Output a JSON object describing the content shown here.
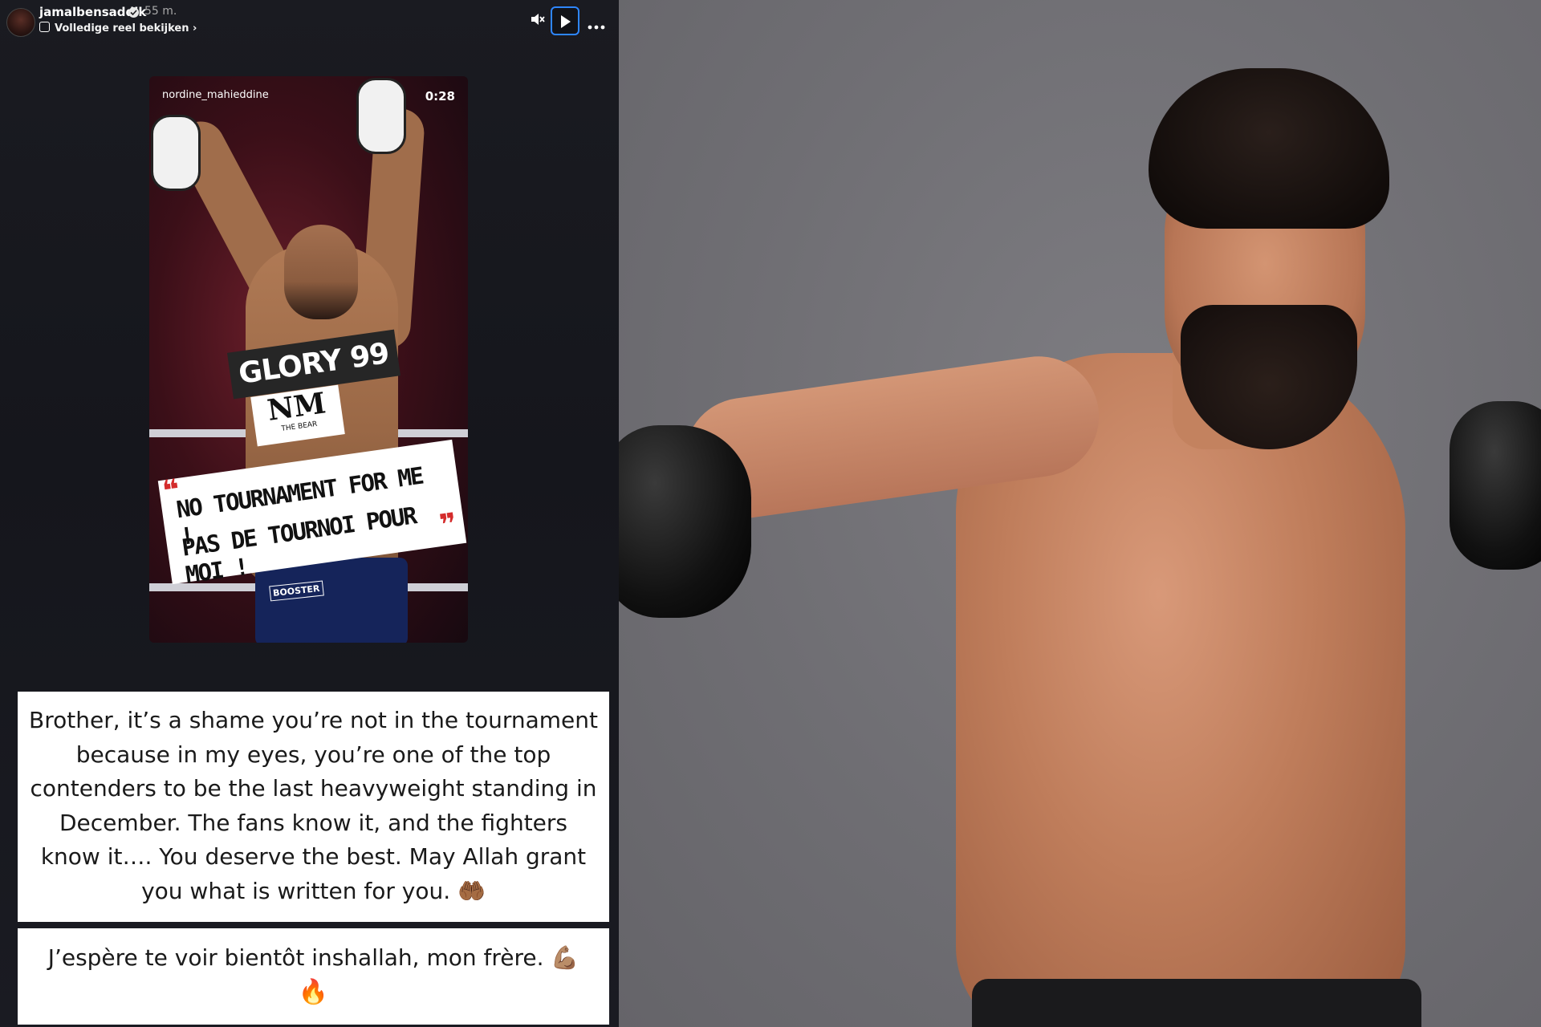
{
  "story": {
    "username": "jamalbensaddik",
    "time_ago": "55 m.",
    "reel_link": "Volledige reel bekijken",
    "icons": {
      "avatar": "profile-avatar",
      "verified": "verified-badge-icon",
      "mute": "speaker-muted-icon",
      "play": "play-icon",
      "more": "more-options-icon",
      "reel": "reel-icon",
      "chevron": "chevron-right-icon"
    },
    "chevron_char": "›"
  },
  "reel": {
    "author": "nordine_mahieddine",
    "duration": "0:28",
    "banner_title": "GLORY 99",
    "logo_mark": "NM",
    "logo_sub": "THE BEAR",
    "headline_line1": "NO TOURNAMENT FOR ME !",
    "headline_line2": "PAS DE TOURNOI POUR MOI !",
    "shorts_label": "BOOSTER"
  },
  "captions": {
    "main": "Brother, it’s a shame you’re not in the tournament because in my eyes, you’re one of the top contenders to be the last heavyweight standing in December. The fans know it, and the fighters know it…. You deserve the best. May Allah grant you what is written for you. 🤲🏾",
    "second": "J’espère te voir bientôt inshallah, mon frère. 💪🏽",
    "second_emoji": "🔥"
  },
  "colors": {
    "panel_bg": "#17181e",
    "accent_focus": "#2e86ff",
    "photo_bg": "#75747a"
  }
}
